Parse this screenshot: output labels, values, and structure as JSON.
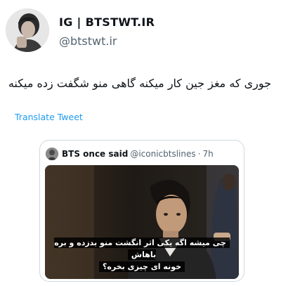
{
  "author": {
    "display_name": "IG | BTSTWT.IR",
    "handle": "@btstwt.ir",
    "avatar_icon": "profile-photo"
  },
  "tweet": {
    "text": "جوری که مغز جین کار میکنه گاهی منو شگفت زده میکنه",
    "translate_label": "Translate Tweet"
  },
  "quoted": {
    "name": "BTS once said",
    "handle": "@iconicbtslines",
    "dot": "·",
    "time": "7h",
    "media_icon": "video-still",
    "caption_line1": "چی میشه اگه یکی اثر انگشت منو بدزده و بره باهاش",
    "caption_line2": "خونه ای چیزی بخره؟"
  },
  "colors": {
    "accent": "#1d9bf0",
    "secondary_text": "#536471",
    "border": "#cfd9de"
  }
}
